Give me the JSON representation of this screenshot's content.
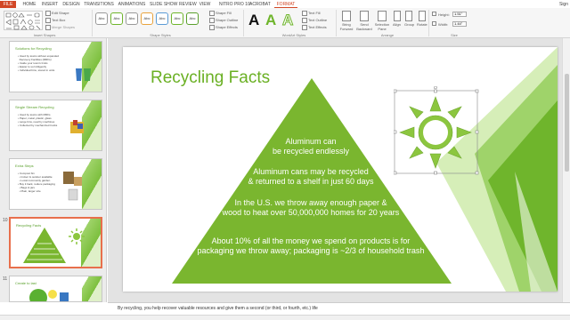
{
  "ribbon": {
    "tabs": [
      "FILE",
      "HOME",
      "INSERT",
      "DESIGN",
      "TRANSITIONS",
      "ANIMATIONS",
      "SLIDE SHOW",
      "REVIEW",
      "VIEW",
      "NITRO PRO 10",
      "ACROBAT",
      "FORMAT"
    ],
    "active_tab": "FORMAT",
    "user": "Sign",
    "insert_shapes": {
      "edit_shape": "Edit Shape",
      "text_box": "Text Box",
      "merge_shapes": "Merge Shapes",
      "group_label": "Insert Shapes"
    },
    "shape_styles": {
      "swatch_label": "Abc",
      "shape_fill": "Shape Fill",
      "shape_outline": "Shape Outline",
      "shape_effects": "Shape Effects",
      "group_label": "Shape Styles"
    },
    "wordart_styles": {
      "glyph": "A",
      "text_fill": "Text Fill",
      "text_outline": "Text Outline",
      "text_effects": "Text Effects",
      "group_label": "WordArt Styles"
    },
    "arrange": {
      "bring_forward": "Bring Forward",
      "send_backward": "Send Backward",
      "selection_pane": "Selection Pane",
      "align": "Align",
      "group": "Group",
      "rotate": "Rotate",
      "group_label": "Arrange"
    },
    "size": {
      "height_label": "Height:",
      "height_value": "1.51\"",
      "width_label": "Width:",
      "width_value": "1.44\"",
      "group_label": "Size"
    }
  },
  "slides_panel": {
    "slides": [
      {
        "num": "",
        "title": "Solutions for Recycling",
        "lines": [
          "• Used by towns without expanded",
          "  Recovery Facilities (MRFs)",
          "• Inside your town's limits",
          "• Easier to sort diligently",
          "• Individual bins, stored in units"
        ]
      },
      {
        "num": "",
        "title": "Single Stream Recycling",
        "lines": [
          "• Used by towns with MRFs",
          "• Paper, metal, plastic, glass",
          "• Large bins, read by machines",
          "• Collected by mechanized trucks"
        ]
      },
      {
        "num": "",
        "title": "Extra Steps",
        "lines": [
          "• Compost bin",
          "  • Indoor & outdoor available",
          "  • Local community garden",
          "• Buy it back, reduce packaging",
          "  • Bags & jars",
          "  • Plain, larger size"
        ]
      },
      {
        "num": "10",
        "title": "Recycling Facts",
        "lines": []
      },
      {
        "num": "11",
        "title": "Create to last",
        "lines": []
      }
    ]
  },
  "slide": {
    "title": "Recycling Facts",
    "facts": [
      "Aluminum can\nbe recycled endlessly",
      "Aluminum cans may be recycled\n& returned to a shelf in just 60 days",
      "In the U.S. we throw away enough paper &\nwood to heat over 50,000,000 homes for 20 years",
      "About 10% of all the money we spend on products is for\npackaging we throw away; packaging is ~2/3 of household trash"
    ],
    "colors": {
      "title": "#6ab023",
      "triangle": "#7ab62f",
      "sun": "#8cc63f",
      "stripe_dark": "#6fb52c",
      "stripe_light": "#d6eeb8"
    }
  },
  "notes": {
    "text": "By recycling, you help recover valuable resources and give them a second (or third, or fourth, etc.) life"
  },
  "icons": [
    "sun-icon",
    "recycle-bin-icon",
    "trash-icon",
    "compost-icon",
    "cup-icon"
  ]
}
